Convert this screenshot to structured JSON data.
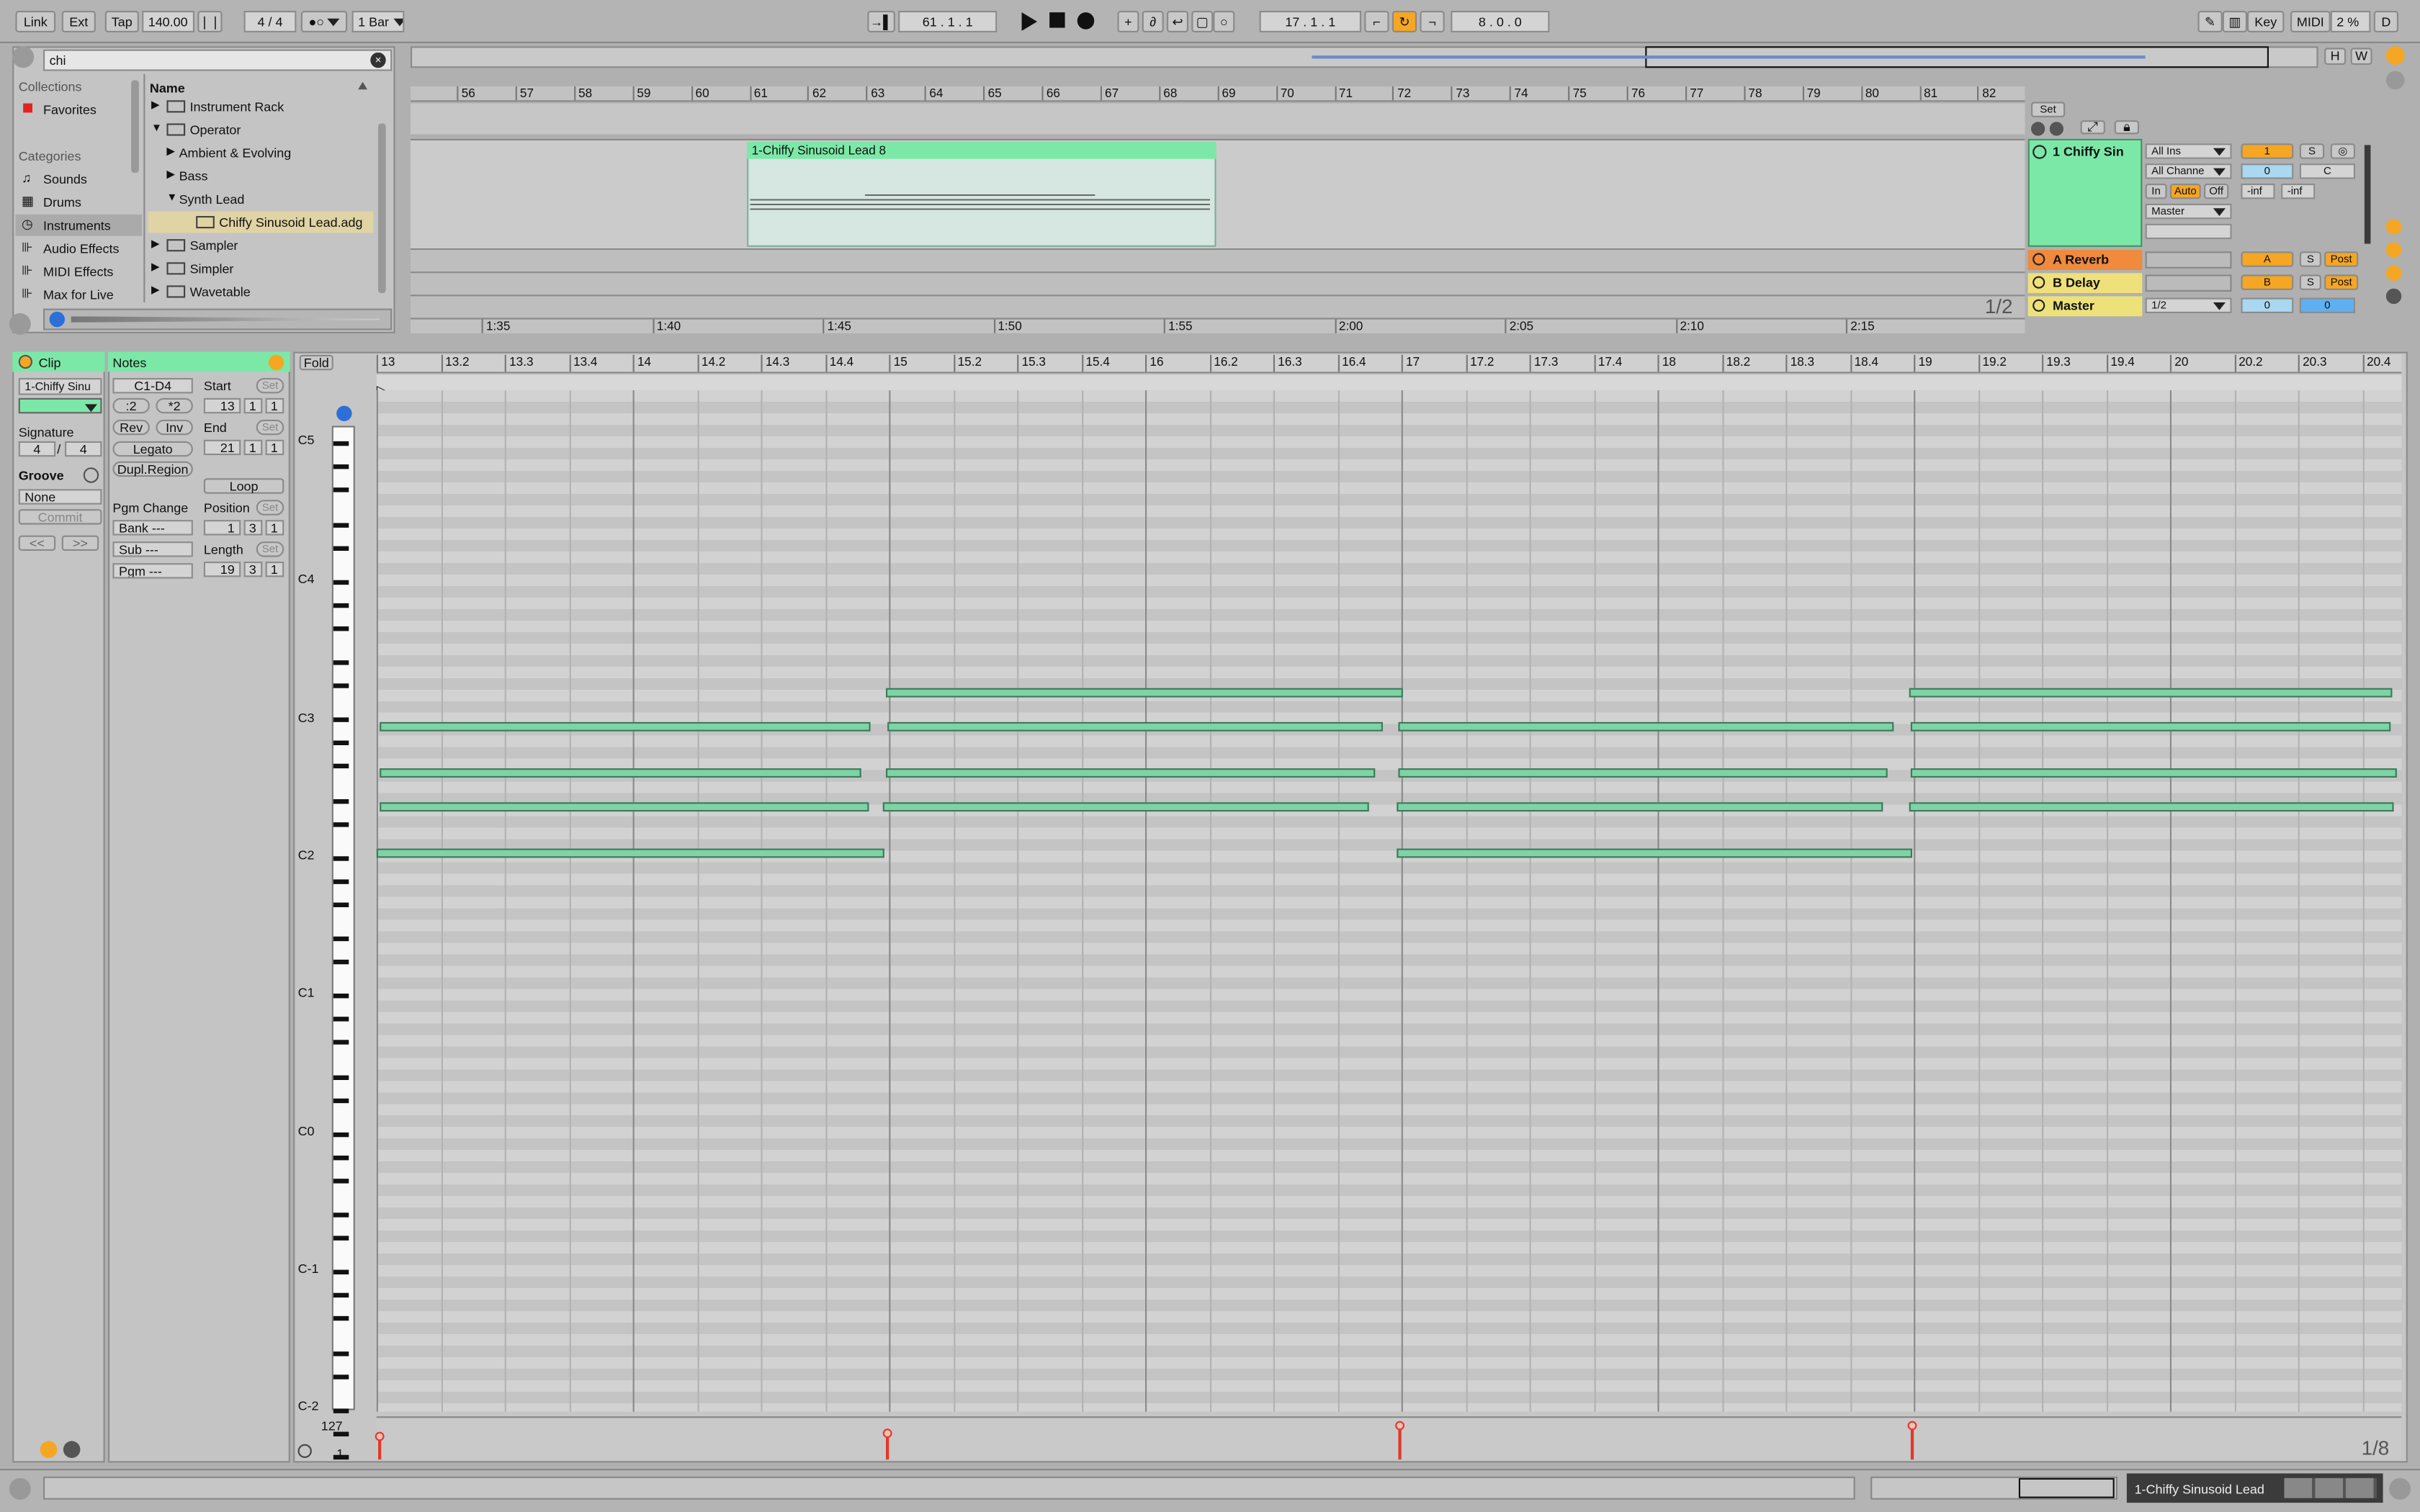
{
  "transport": {
    "link": "Link",
    "ext": "Ext",
    "tap": "Tap",
    "tempo": "140.00",
    "sig": "4 / 4",
    "quant": "1 Bar",
    "position": "61 . 1 . 1",
    "loop_start": "17 . 1 . 1",
    "loop_len": "8 . 0 . 0",
    "key": "Key",
    "midi": "MIDI",
    "cpu": "2 %",
    "d": "D"
  },
  "browser": {
    "search": "chi",
    "collections_label": "Collections",
    "favorites": "Favorites",
    "categories_label": "Categories",
    "categories": [
      "Sounds",
      "Drums",
      "Instruments",
      "Audio Effects",
      "MIDI Effects",
      "Max for Live"
    ],
    "column": "Name",
    "items": [
      "Instrument Rack",
      "Operator",
      "Ambient & Evolving",
      "Bass",
      "Synth Lead",
      "Chiffy Sinusoid Lead.adg",
      "Sampler",
      "Simpler",
      "Wavetable"
    ]
  },
  "arrange": {
    "bars": [
      "56",
      "57",
      "58",
      "59",
      "60",
      "61",
      "62",
      "63",
      "64",
      "65",
      "66",
      "67",
      "68",
      "69",
      "70",
      "71",
      "72",
      "73",
      "74",
      "75",
      "76",
      "77",
      "78",
      "79",
      "80",
      "81",
      "82"
    ],
    "times": [
      "1:35",
      "1:40",
      "1:45",
      "1:50",
      "1:55",
      "2:00",
      "2:05",
      "2:10",
      "2:15"
    ],
    "clip_name": "1-Chiffy Sinusoid Lead 8",
    "zoom": "1/2",
    "set": "Set",
    "h": "H",
    "w": "W"
  },
  "tracks": {
    "main": "1 Chiffy Sin",
    "reverb": "A Reverb",
    "delay": "B Delay",
    "master": "Master",
    "all_ins": "All Ins",
    "all_channels": "All Channe",
    "in": "In",
    "auto": "Auto",
    "off": "Off",
    "master_out": "Master",
    "num": "1",
    "s": "S",
    "vol": "0",
    "pan": "C",
    "inf1": "-inf",
    "inf2": "-inf",
    "a": "A",
    "b": "B",
    "post": "Post",
    "master_sel": "1/2",
    "master_vol": "0",
    "master_pan": "0"
  },
  "clip": {
    "title": "Clip",
    "name": "1-Chiffy Sinu",
    "signature_label": "Signature",
    "sig_num": "4",
    "sig_den": "4",
    "groove_label": "Groove",
    "groove": "None",
    "commit": "Commit",
    "prev": "<<",
    "next": ">>"
  },
  "notes": {
    "title": "Notes",
    "range": "C1-D4",
    "half": ":2",
    "double": "*2",
    "rev": "Rev",
    "inv": "Inv",
    "legato": "Legato",
    "dupl": "Dupl.Region",
    "pgm_change": "Pgm Change",
    "bank": "Bank ---",
    "sub": "Sub ---",
    "pgm": "Pgm ---",
    "start_label": "Start",
    "start": [
      "13",
      "1",
      "1"
    ],
    "end_label": "End",
    "end": [
      "21",
      "1",
      "1"
    ],
    "loop": "Loop",
    "position_label": "Position",
    "position": [
      "1",
      "3",
      "1"
    ],
    "length_label": "Length",
    "length": [
      "19",
      "3",
      "1"
    ],
    "set": "Set"
  },
  "editor": {
    "fold": "Fold",
    "ruler": [
      "13",
      "13.2",
      "13.3",
      "13.4",
      "14",
      "14.2",
      "14.3",
      "14.4",
      "15",
      "15.2",
      "15.3",
      "15.4",
      "16",
      "16.2",
      "16.3",
      "16.4",
      "17",
      "17.2",
      "17.3",
      "17.4",
      "18",
      "18.2",
      "18.3",
      "18.4",
      "19",
      "19.2",
      "19.3",
      "19.4",
      "20",
      "20.2",
      "20.3",
      "20.4"
    ],
    "octaves": [
      "C5",
      "C4",
      "C3",
      "C2",
      "C1",
      "C0",
      "C-1",
      "C-2"
    ],
    "vel_max": "127",
    "vel_min": "1",
    "zoom": "1/8"
  },
  "status": {
    "clip": "1-Chiffy Sinusoid Lead"
  },
  "colors": {
    "accent": "#f5a623",
    "clip": "#7fd3a6",
    "track_green": "#7ce8a8",
    "reverb": "#f08a3c",
    "delay": "#f0e07a",
    "master": "#ede27a",
    "velocity": "#e03a2a"
  }
}
